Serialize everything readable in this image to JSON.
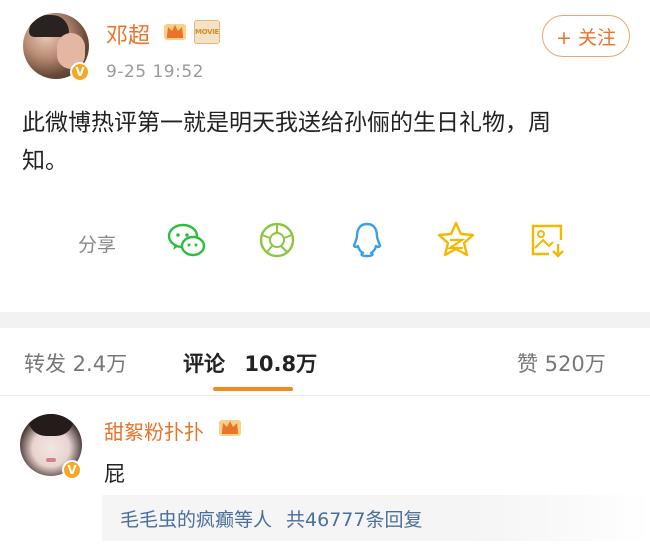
{
  "post": {
    "username": "邓超",
    "movie_badge": "MOVIE",
    "time": "9-25  19:52",
    "follow_label": "+ 关注",
    "content": "此微博热评第一就是明天我送给孙俪的生日礼物，周知。"
  },
  "share": {
    "label": "分享",
    "targets": [
      "wechat-icon",
      "moments-icon",
      "qq-icon",
      "qzone-icon",
      "save-image-icon"
    ]
  },
  "tabs": {
    "repost": "转发  2.4万",
    "comments_label": "评论",
    "comments_count": "10.8万",
    "likes": "赞  520万"
  },
  "comment": {
    "username": "甜絮粉扑扑",
    "text": "屁",
    "reply_users": "毛毛虫的疯癫等人",
    "reply_count": "共46777条回复"
  },
  "colors": {
    "accent_orange": "#e8742a",
    "tab_underline": "#f28a1f",
    "verified": "#f6a623",
    "reply_link": "#4a6f9c",
    "wechat_green": "#2dbe3f",
    "qq_blue": "#3aa0e6",
    "qzone_yellow": "#f5b800"
  }
}
